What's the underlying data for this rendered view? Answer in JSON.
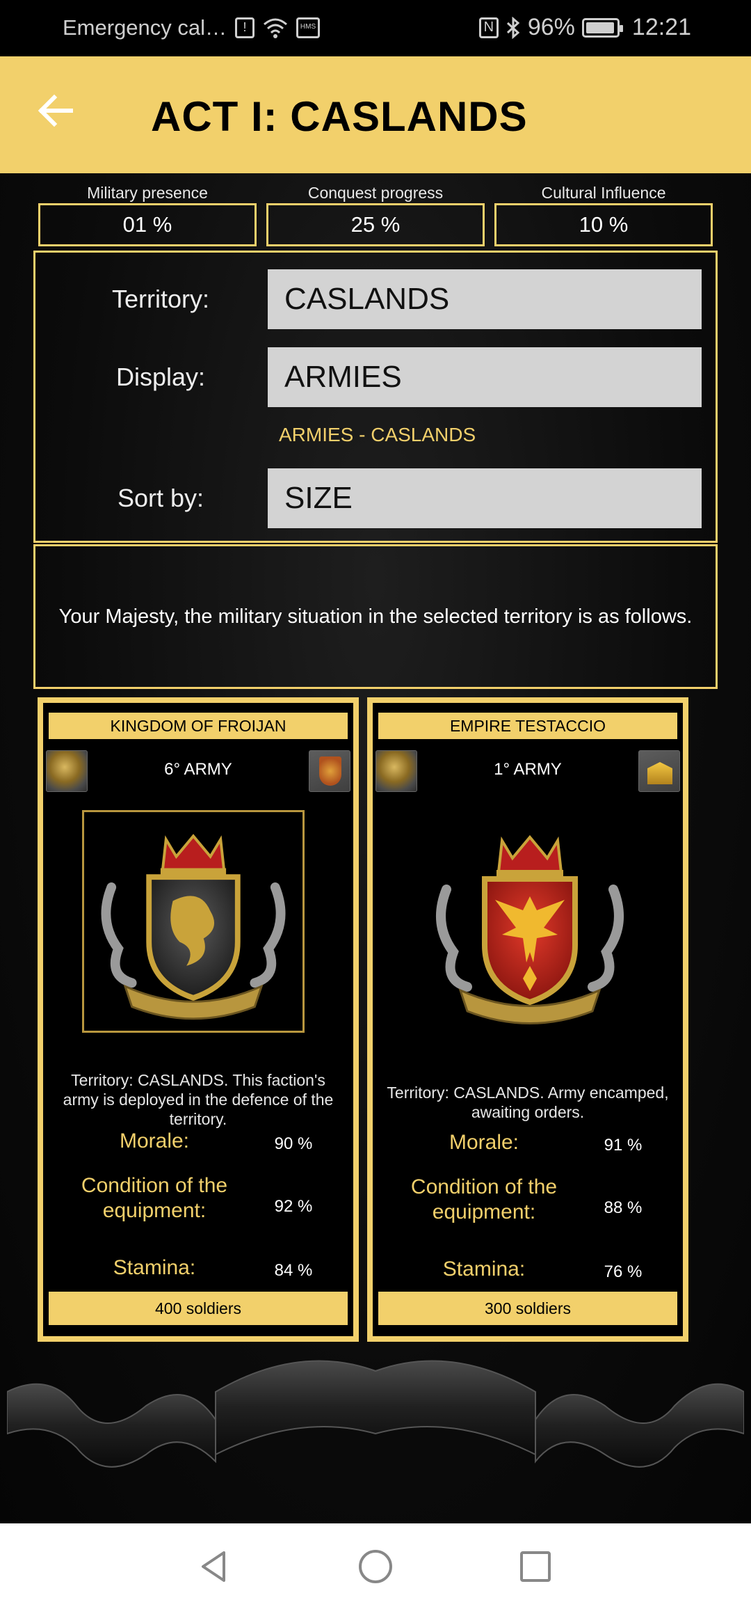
{
  "status_bar": {
    "carrier": "Emergency cal…",
    "battery": "96%",
    "time": "12:21",
    "icons": [
      "sim-alert-icon",
      "wifi-icon",
      "hms-icon",
      "nfc-icon",
      "bluetooth-icon",
      "battery-icon"
    ]
  },
  "header": {
    "title": "ACT I: CASLANDS",
    "back_icon": "arrow-left-icon"
  },
  "stats": [
    {
      "label": "Military presence",
      "value": "01 %"
    },
    {
      "label": "Conquest progress",
      "value": "25 %"
    },
    {
      "label": "Cultural Influence",
      "value": "10 %"
    }
  ],
  "filters": {
    "territory_label": "Territory:",
    "territory_value": "CASLANDS",
    "display_label": "Display:",
    "display_value": "ARMIES",
    "display_subtitle": "ARMIES - CASLANDS",
    "sort_label": "Sort by:",
    "sort_value": "SIZE"
  },
  "message": "Your Majesty, the military situation in the selected territory is as follows.",
  "armies": [
    {
      "faction": "KINGDOM OF FROIJAN",
      "army": "6° ARMY",
      "description": "Territory: CASLANDS. This faction's army is deployed in the defence of the territory.",
      "morale_label": "Morale:",
      "morale": "90 %",
      "equipment_label": "Condition of the equipment:",
      "equipment": "92 %",
      "stamina_label": "Stamina:",
      "stamina": "84 %",
      "soldiers": "400 soldiers",
      "crest_color": "#3b3b3b",
      "emblem_color": "#c9a33a"
    },
    {
      "faction": "EMPIRE TESTACCIO",
      "army": "1° ARMY",
      "description": "Territory: CASLANDS. Army encamped, awaiting orders.",
      "morale_label": "Morale:",
      "morale": "91 %",
      "equipment_label": "Condition of the equipment:",
      "equipment": "88 %",
      "stamina_label": "Stamina:",
      "stamina": "76 %",
      "soldiers": "300 soldiers",
      "crest_color": "#c4221a",
      "emblem_color": "#f0b92f"
    }
  ],
  "colors": {
    "accent": "#f2d06b",
    "field": "#d3d3d3",
    "background": "#000000"
  }
}
